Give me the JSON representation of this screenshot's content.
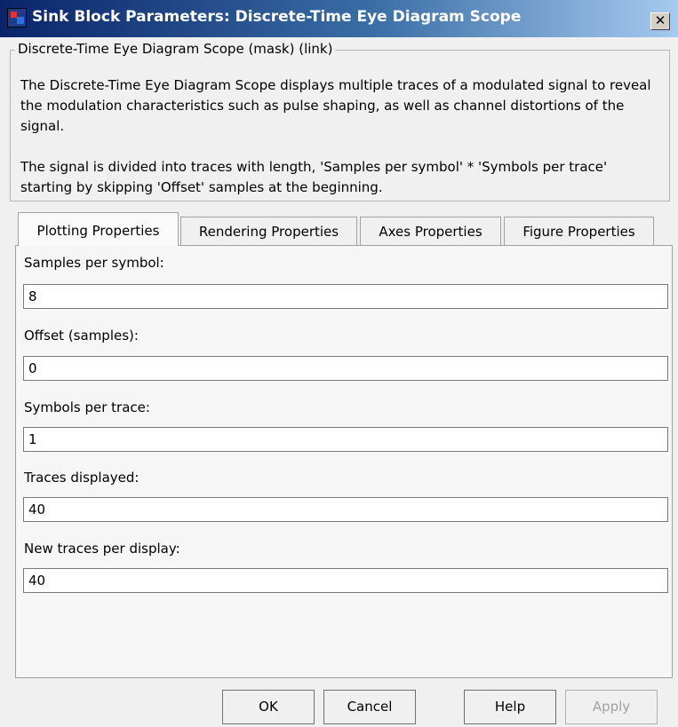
{
  "window": {
    "title": "Sink Block Parameters: Discrete-Time Eye Diagram Scope",
    "close_glyph": "✕"
  },
  "group": {
    "legend": "Discrete-Time Eye Diagram Scope (mask) (link)",
    "description_1": [
      "The Discrete-Time Eye Diagram Scope displays multiple traces of a modulated signal to reveal",
      "the modulation characteristics such as pulse shaping, as well as channel distortions of the",
      "signal."
    ],
    "description_2": [
      "The signal is divided into traces with length, 'Samples per symbol'  * 'Symbols per trace'",
      "starting by skipping 'Offset' samples at the beginning."
    ]
  },
  "tabs": [
    {
      "label": "Plotting Properties",
      "active": true
    },
    {
      "label": "Rendering Properties",
      "active": false
    },
    {
      "label": "Axes Properties",
      "active": false
    },
    {
      "label": "Figure Properties",
      "active": false
    }
  ],
  "fields": [
    {
      "label": "Samples per symbol:",
      "value": "8"
    },
    {
      "label": "Offset (samples):",
      "value": "0"
    },
    {
      "label": "Symbols per trace:",
      "value": "1"
    },
    {
      "label": "Traces displayed:",
      "value": "40"
    },
    {
      "label": "New traces per display:",
      "value": "40"
    }
  ],
  "buttons": {
    "ok": "OK",
    "cancel": "Cancel",
    "help": "Help",
    "apply": "Apply"
  }
}
